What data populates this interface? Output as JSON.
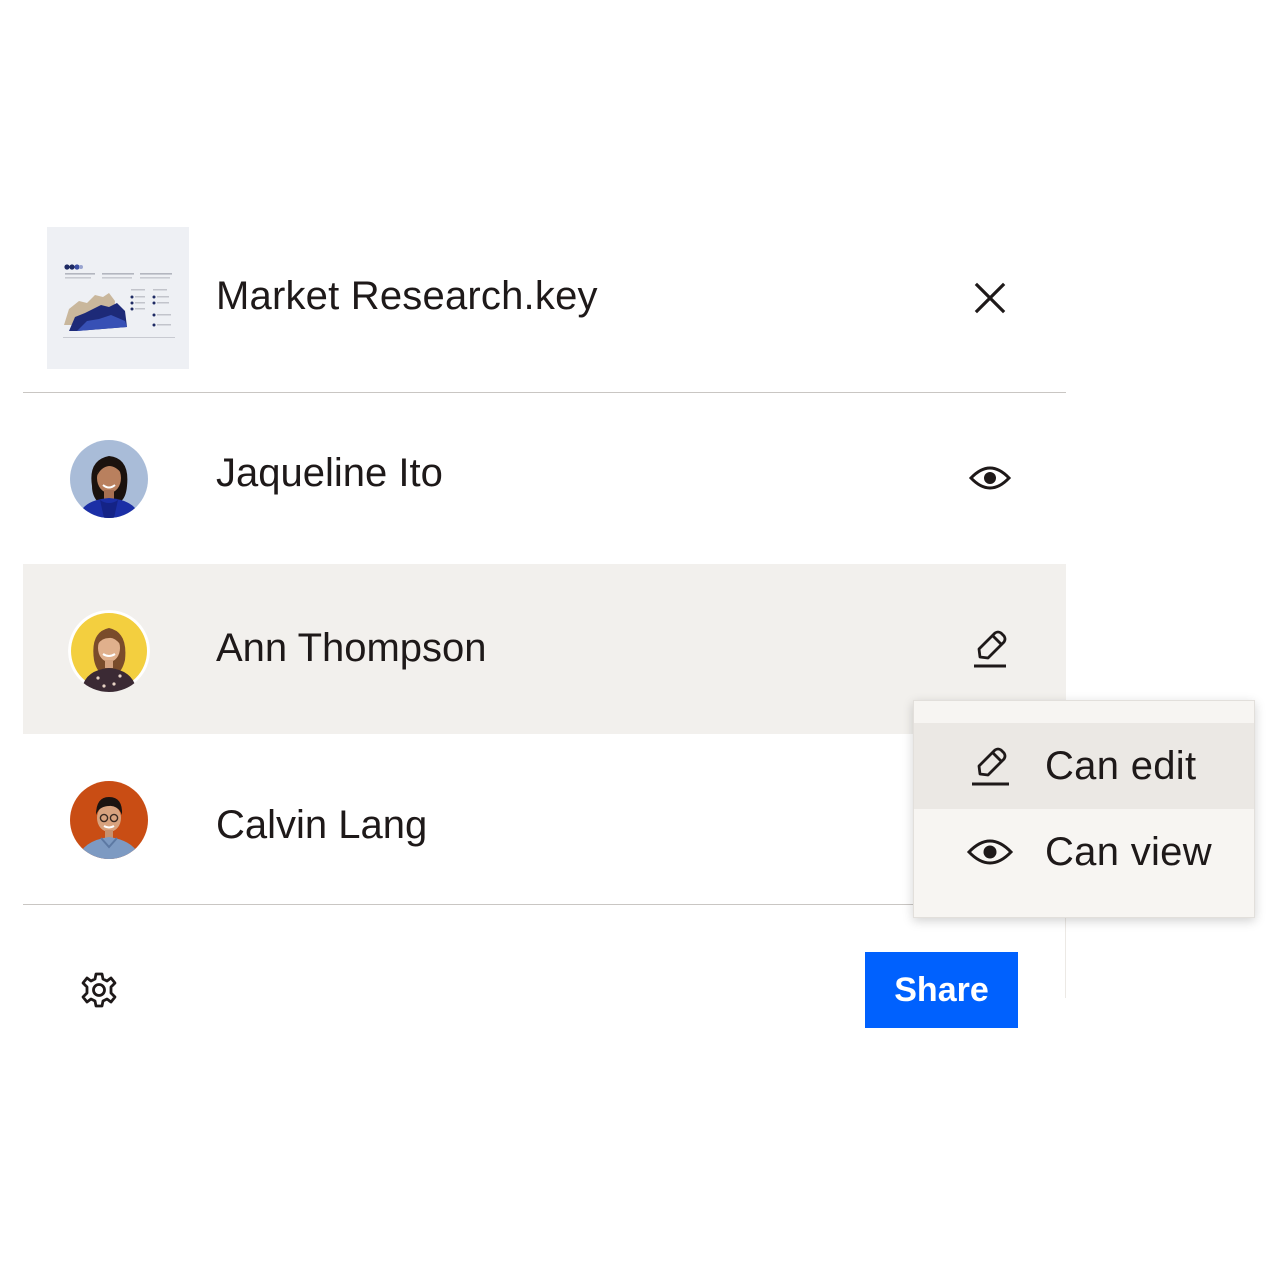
{
  "file": {
    "name": "Market Research.key",
    "thumbnail_icon": "keynote-slide-thumbnail"
  },
  "header": {
    "close_icon": "close-icon"
  },
  "members": [
    {
      "name": "Jaqueline Ito",
      "permission": "view",
      "permission_icon": "eye-icon",
      "avatar_bg": "#a9bcd8",
      "highlighted": false
    },
    {
      "name": "Ann Thompson",
      "permission": "edit",
      "permission_icon": "pencil-icon",
      "avatar_bg": "#f3cf3f",
      "highlighted": true
    },
    {
      "name": "Calvin Lang",
      "permission": "",
      "permission_icon": "",
      "avatar_bg": "#c94d14",
      "highlighted": false
    }
  ],
  "permission_menu": {
    "items": [
      {
        "label": "Can edit",
        "icon": "pencil-icon",
        "active": true
      },
      {
        "label": "Can view",
        "icon": "eye-icon",
        "active": false
      }
    ]
  },
  "footer": {
    "settings_icon": "gear-icon",
    "share_label": "Share"
  },
  "colors": {
    "accent": "#0061fe",
    "row_highlight": "#f2f0ed",
    "menu_background": "#f7f5f2",
    "menu_active": "#ebe8e4",
    "text": "#1e1919"
  }
}
